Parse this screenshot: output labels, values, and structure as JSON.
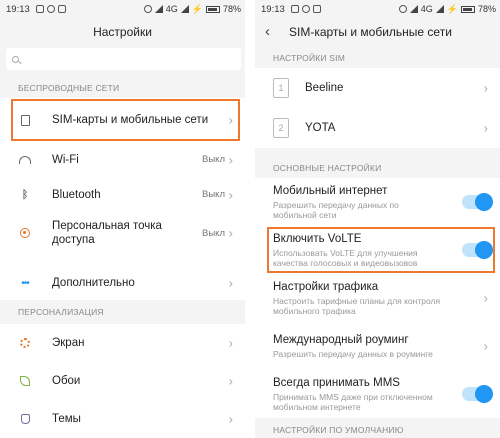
{
  "left": {
    "status": {
      "time": "19:13",
      "network": "4G",
      "battery": "78%"
    },
    "title": "Настройки",
    "section_wireless": "БЕСПРОВОДНЫЕ СЕТИ",
    "items": [
      {
        "label": "SIM-карты и мобильные сети",
        "value": ""
      },
      {
        "label": "Wi-Fi",
        "value": "Выкл"
      },
      {
        "label": "Bluetooth",
        "value": "Выкл"
      },
      {
        "label": "Персональная точка доступа",
        "value": "Выкл"
      },
      {
        "label": "Дополнительно",
        "value": ""
      }
    ],
    "section_personal": "ПЕРСОНАЛИЗАЦИЯ",
    "personal_items": [
      {
        "label": "Экран"
      },
      {
        "label": "Обои"
      },
      {
        "label": "Темы"
      }
    ]
  },
  "right": {
    "status": {
      "time": "19:13",
      "network": "4G",
      "battery": "78%"
    },
    "title": "SIM-карты и мобильные сети",
    "section_sim": "НАСТРОЙКИ SIM",
    "sims": [
      {
        "slot": "1",
        "name": "Beeline"
      },
      {
        "slot": "2",
        "name": "YOTA"
      }
    ],
    "section_basic": "ОСНОВНЫЕ НАСТРОЙКИ",
    "settings": [
      {
        "title": "Мобильный интернет",
        "subtitle": "Разрешить передачу данных по мобильной сети",
        "toggle": true
      },
      {
        "title": "Включить VoLTE",
        "subtitle": "Использовать VoLTE для улучшения качества голосовых и видеовызовов",
        "toggle": true
      },
      {
        "title": "Настройки трафика",
        "subtitle": "Настроить тарифные планы для контроля мобильного трафика",
        "toggle": false
      },
      {
        "title": "Международный роуминг",
        "subtitle": "Разрешить передачу данных в роуминге",
        "toggle": false
      },
      {
        "title": "Всегда принимать MMS",
        "subtitle": "Принимать MMS даже при отключенном мобильном интернете",
        "toggle": true
      }
    ],
    "section_default": "НАСТРОЙКИ ПО УМОЛЧАНИЮ"
  },
  "colors": {
    "accent": "#2196f3",
    "highlight": "#f0782c",
    "toggle_track": "#bfe3fb"
  }
}
